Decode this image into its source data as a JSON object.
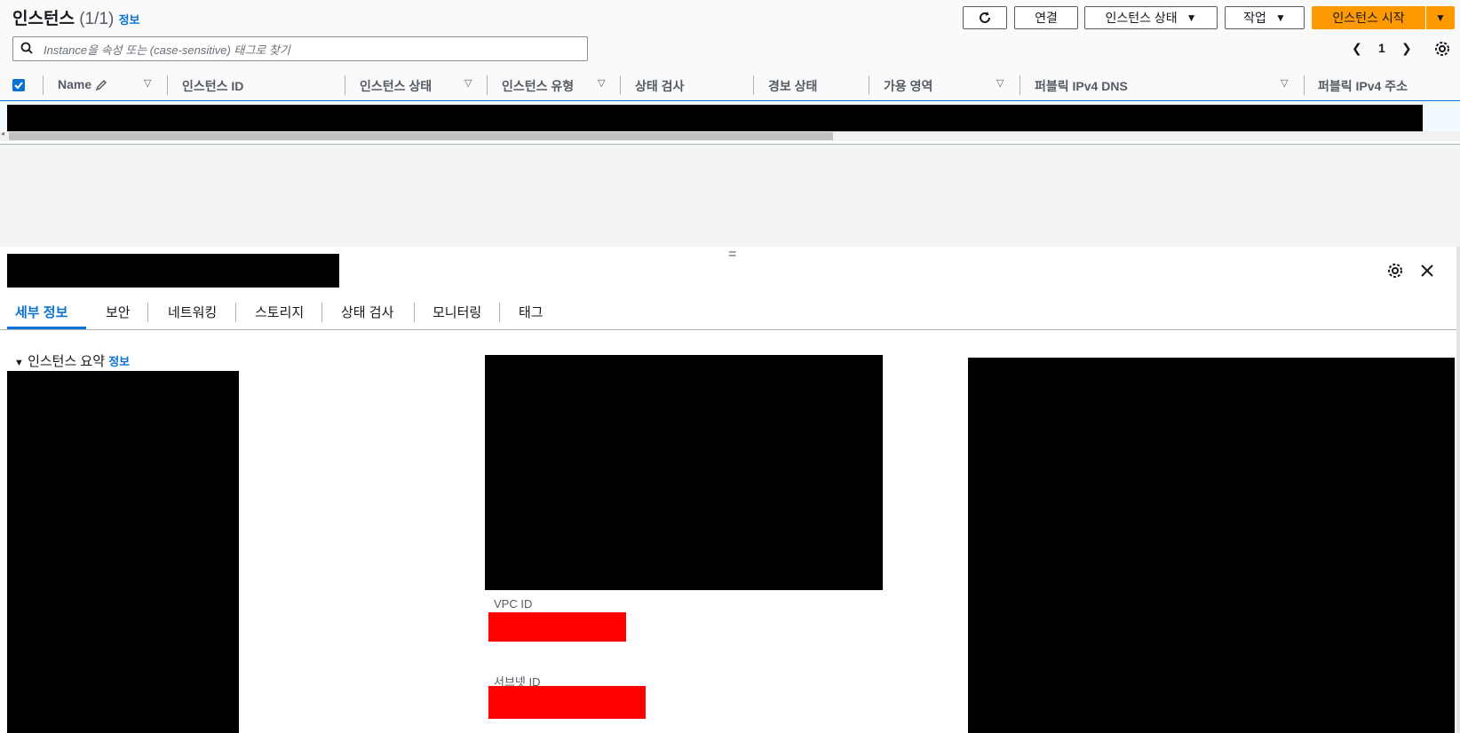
{
  "header": {
    "title": "인스턴스",
    "count": "(1/1)",
    "info": "정보"
  },
  "toolbar": {
    "refresh_icon": "refresh-icon",
    "connect_label": "연결",
    "instance_state_label": "인스턴스 상태",
    "actions_label": "작업",
    "launch_label": "인스턴스 시작"
  },
  "search": {
    "placeholder": "Instance을 속성 또는 (case-sensitive) 태그로 찾기"
  },
  "pagination": {
    "current_page": "1"
  },
  "table": {
    "columns": [
      "Name",
      "인스턴스 ID",
      "인스턴스 상태",
      "인스턴스 유형",
      "상태 검사",
      "경보 상태",
      "가용 영역",
      "퍼블릭 IPv4 DNS",
      "퍼블릭 IPv4 주소"
    ]
  },
  "details": {
    "tabs": [
      "세부 정보",
      "보안",
      "네트워킹",
      "스토리지",
      "상태 검사",
      "모니터링",
      "태그"
    ],
    "active_tab": "세부 정보",
    "section_title": "인스턴스 요약",
    "section_info": "정보",
    "vpc_label": "VPC ID",
    "subnet_label": "서브넷 ID"
  },
  "colors": {
    "accent": "#0972d3",
    "primary_button": "#ff9900",
    "redaction": "#000000",
    "highlight_redaction": "#ff0000"
  }
}
